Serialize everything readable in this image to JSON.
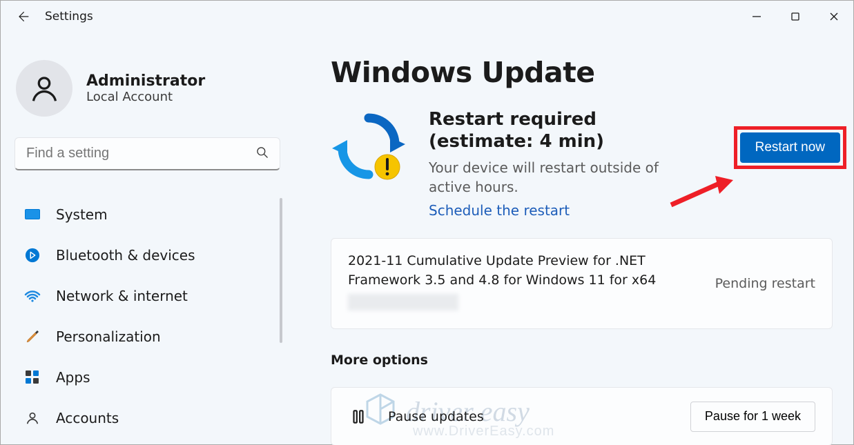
{
  "titlebar": {
    "title": "Settings"
  },
  "profile": {
    "name": "Administrator",
    "subtitle": "Local Account"
  },
  "search": {
    "placeholder": "Find a setting"
  },
  "sidebar": {
    "items": [
      {
        "label": "System"
      },
      {
        "label": "Bluetooth & devices"
      },
      {
        "label": "Network & internet"
      },
      {
        "label": "Personalization"
      },
      {
        "label": "Apps"
      },
      {
        "label": "Accounts"
      }
    ]
  },
  "page": {
    "title": "Windows Update"
  },
  "restart": {
    "heading": "Restart required (estimate: 4 min)",
    "subtext": "Your device will restart outside of active hours.",
    "link": "Schedule the restart",
    "button": "Restart now"
  },
  "update": {
    "title_line1": "2021-11 Cumulative Update Preview for .NET",
    "title_line2": "Framework 3.5 and 4.8 for Windows 11 for x64",
    "status": "Pending restart"
  },
  "more_options": {
    "heading": "More options"
  },
  "pause": {
    "label": "Pause updates",
    "button": "Pause for 1 week"
  },
  "watermark": {
    "line1": "driver easy",
    "line2": "www.DriverEasy.com"
  }
}
